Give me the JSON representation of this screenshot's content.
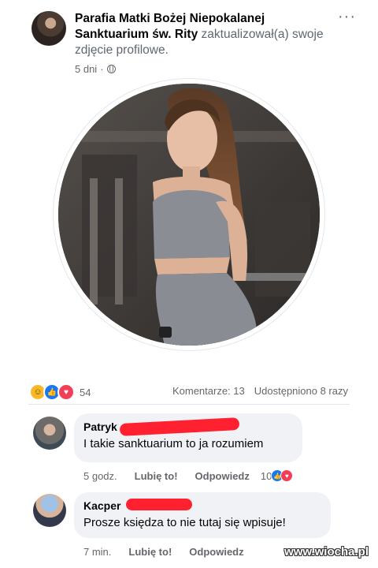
{
  "post": {
    "author": "Parafia Matki Bożej Niepokalanej Sanktuarium św. Rity",
    "action": "zaktualizował(a) swoje zdjęcie profilowe.",
    "time": "5 dni",
    "separator": "·",
    "more_label": "···"
  },
  "engagement": {
    "reaction_count": "54",
    "comments": "Komentarze: 13",
    "shares": "Udostępniono 8 razy"
  },
  "comments": [
    {
      "author": "Patryk",
      "text": "I takie sanktuarium to ja rozumiem",
      "time": "5 godz.",
      "like": "Lubię to!",
      "reply": "Odpowiedz",
      "reactions": "10"
    },
    {
      "author": "Kacper",
      "text": "Prosze księdza to nie tutaj się wpisuje!",
      "time": "7 min.",
      "like": "Lubię to!",
      "reply": "Odpowiedz"
    }
  ],
  "watermark": "www.wiocha.pl",
  "colors": {
    "like_blue": "#1877f2",
    "love_red": "#f33e58",
    "haha_yellow": "#f7b928",
    "redaction": "#ff2030"
  }
}
